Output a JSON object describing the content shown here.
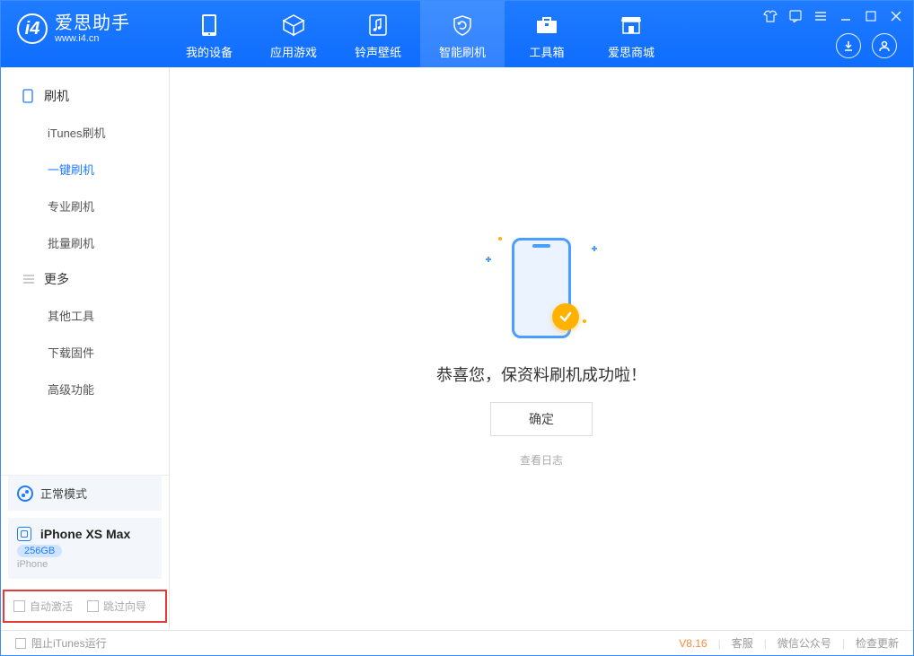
{
  "app": {
    "title": "爱思助手",
    "subtitle": "www.i4.cn"
  },
  "tabs": [
    {
      "label": "我的设备"
    },
    {
      "label": "应用游戏"
    },
    {
      "label": "铃声壁纸"
    },
    {
      "label": "智能刷机"
    },
    {
      "label": "工具箱"
    },
    {
      "label": "爱思商城"
    }
  ],
  "sidebar": {
    "section1": {
      "title": "刷机",
      "items": [
        "iTunes刷机",
        "一键刷机",
        "专业刷机",
        "批量刷机"
      ]
    },
    "section2": {
      "title": "更多",
      "items": [
        "其他工具",
        "下载固件",
        "高级功能"
      ]
    }
  },
  "mode": {
    "label": "正常模式"
  },
  "device": {
    "name": "iPhone XS Max",
    "capacity": "256GB",
    "type": "iPhone"
  },
  "checkboxes": {
    "auto_activate": "自动激活",
    "skip_wizard": "跳过向导"
  },
  "content": {
    "success_msg": "恭喜您，保资料刷机成功啦！",
    "ok_button": "确定",
    "view_log": "查看日志"
  },
  "footer": {
    "block_itunes": "阻止iTunes运行",
    "version": "V8.16",
    "links": [
      "客服",
      "微信公众号",
      "检查更新"
    ]
  }
}
